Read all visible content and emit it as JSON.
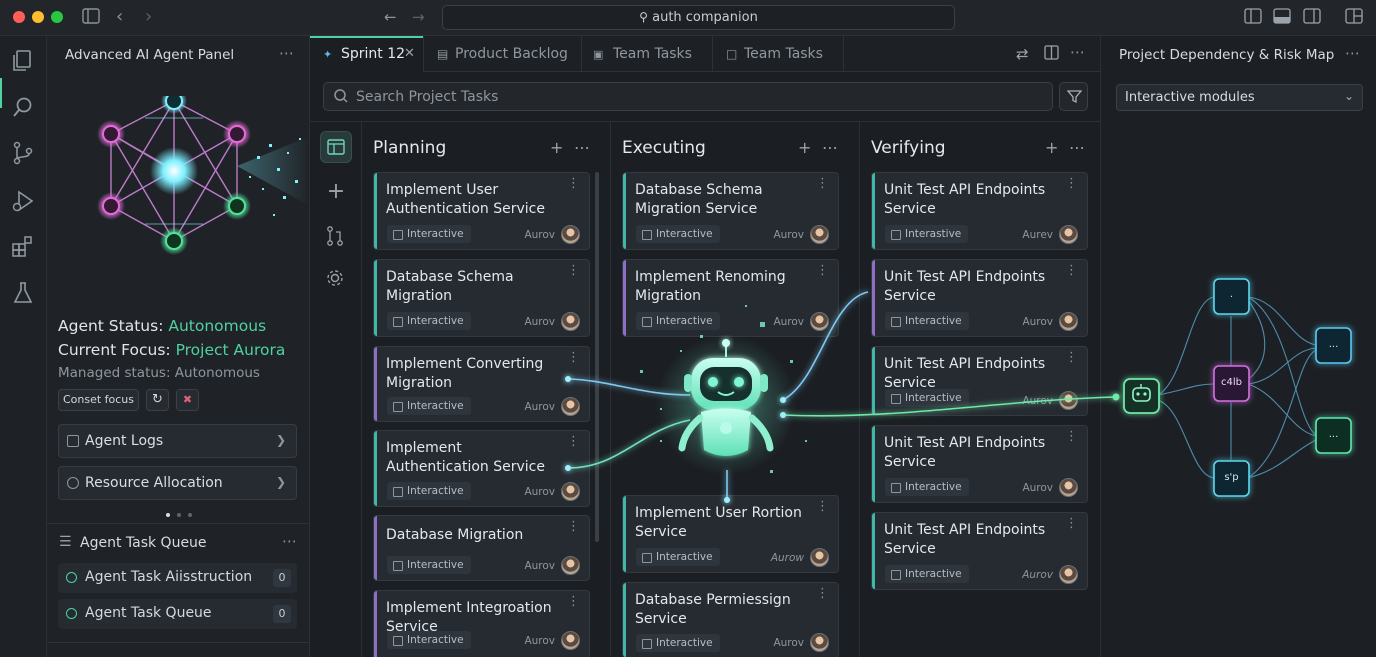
{
  "titlebar": {
    "search": "auth companion"
  },
  "left_panel": {
    "title": "Advanced AI Agent Panel",
    "status_label": "Agent Status: ",
    "status_value": "Autonomous",
    "focus_label": "Current Focus: ",
    "focus_value": "Project Aurora",
    "managed": "Managed status: Autonomous",
    "reset_focus": "Conset focus",
    "rows": [
      {
        "label": "Agent Logs"
      },
      {
        "label": "Resource Allocation"
      }
    ],
    "queue_title": "Agent Task Queue",
    "queue": [
      {
        "label": "Agent Task Aiisstruction",
        "count": "0"
      },
      {
        "label": "Agent Task Queue",
        "count": "0"
      }
    ]
  },
  "tabs": [
    {
      "label": "Sprint 12"
    },
    {
      "label": "Product Backlog"
    },
    {
      "label": "Team Tasks"
    },
    {
      "label": "Team Tasks"
    }
  ],
  "board": {
    "search_placeholder": "Search Project Tasks",
    "columns": [
      {
        "title": "Planning",
        "cards": [
          {
            "title": "Implement User Authentication Service",
            "tag": "Interactive",
            "owner": "Aurov"
          },
          {
            "title": "Database Schema Migration",
            "tag": "Interactive",
            "owner": "Aurov"
          },
          {
            "title": "Implement Converting Migration",
            "tag": "Interactive",
            "owner": "Aurov"
          },
          {
            "title": "Implement Authentication Service",
            "tag": "Interactive",
            "owner": "Aurov"
          },
          {
            "title": "Database Migration",
            "tag": "Interactive",
            "owner": "Aurov"
          },
          {
            "title": "Implement Integroation Service",
            "tag": "Interactive",
            "owner": "Aurov"
          }
        ]
      },
      {
        "title": "Executing",
        "cards": [
          {
            "title": "Database Schema Migration Service",
            "tag": "Interactive",
            "owner": "Aurov"
          },
          {
            "title": "Implement Renoming Migration",
            "tag": "Interactive",
            "owner": "Aurov"
          },
          {
            "title": "Implement User Rortion Service",
            "tag": "Interactive",
            "owner": "Aurow"
          },
          {
            "title": "Database Permiessign Service",
            "tag": "Interactive",
            "owner": "Aurov"
          }
        ]
      },
      {
        "title": "Verifying",
        "cards": [
          {
            "title": "Unit Test API Endpoints Service",
            "tag": "Interastive",
            "owner": "Aurev"
          },
          {
            "title": "Unit Test API Endpoints Service",
            "tag": "Interactive",
            "owner": "Aurov"
          },
          {
            "title": "Unit Test API Endpoints Service",
            "tag": "Interactive",
            "owner": "Aurov"
          },
          {
            "title": "Unit Test API Endpoints Service",
            "tag": "Interactive",
            "owner": "Aurov"
          },
          {
            "title": "Unit Test API Endpoints Service",
            "tag": "Interactive",
            "owner": "Aurov"
          }
        ]
      }
    ]
  },
  "right_panel": {
    "title": "Project Dependency & Risk Map",
    "select_value": "Interactive modules",
    "nodes": [
      ".",
      "...",
      "c4lb",
      "...",
      "s'p"
    ]
  },
  "colors": {
    "accent": "#4fd1a0",
    "purple": "#8e6fc4",
    "teal": "#3fb8a8",
    "glow": "#7ef0ff"
  }
}
